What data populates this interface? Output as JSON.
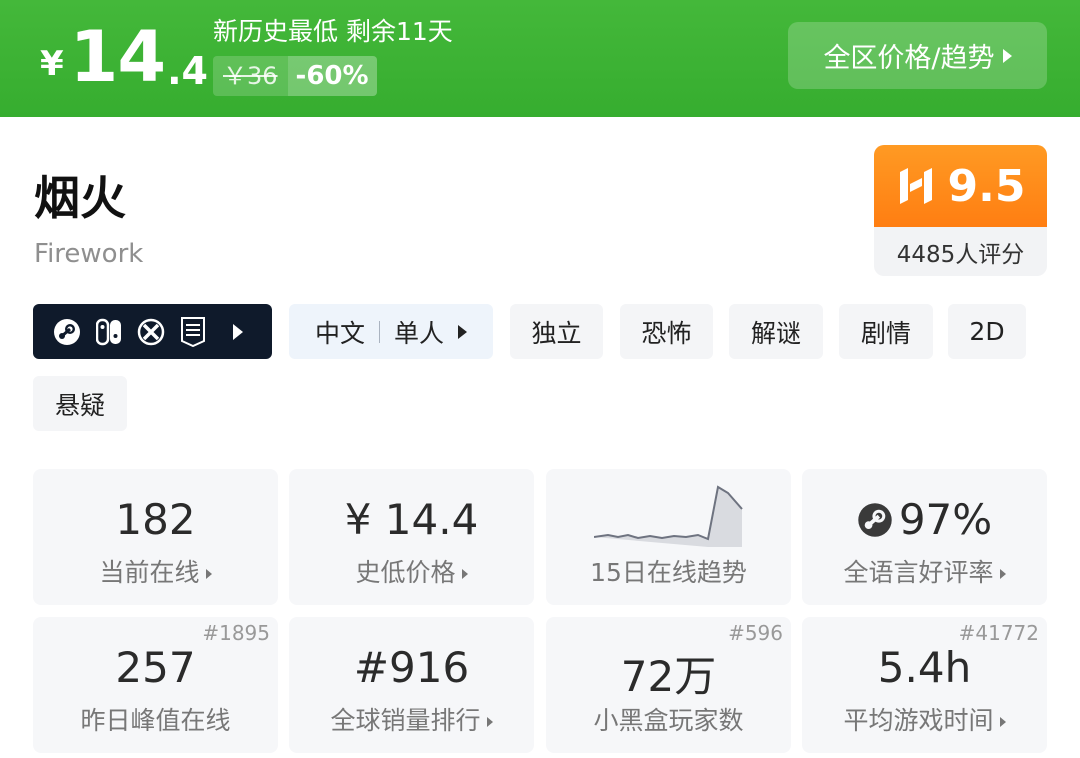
{
  "banner": {
    "currency": "¥",
    "price_int": "14",
    "price_dec": ".4",
    "promo_text": "新历史最低 剩余11天",
    "original_price": "￥36",
    "discount": "-60%",
    "region_button": "全区价格/趋势",
    "bg_color": "#3db435"
  },
  "game": {
    "title": "烟火",
    "subtitle": "Firework"
  },
  "score": {
    "value": "9.5",
    "count": "4485人评分",
    "accent": "#ff8a1a"
  },
  "platforms": {
    "icons": [
      "steam-icon",
      "switch-icon",
      "xbox-icon",
      "epic-games-icon"
    ]
  },
  "tags": {
    "lang_a": "中文",
    "lang_b": "单人",
    "items": [
      "独立",
      "恐怖",
      "解谜",
      "剧情",
      "2D",
      "悬疑"
    ]
  },
  "stats": [
    {
      "value": "182",
      "label": "当前在线"
    },
    {
      "value": "¥ 14.4",
      "label": "史低价格"
    },
    {
      "value": "",
      "label": "15日在线趋势"
    },
    {
      "value": "97%",
      "label": "全语言好评率"
    },
    {
      "value": "257",
      "label": "昨日峰值在线",
      "rank": "#1895"
    },
    {
      "value": "#916",
      "label": "全球销量排行"
    },
    {
      "value": "72万",
      "label": "小黑盒玩家数",
      "rank": "#596"
    },
    {
      "value": "5.4h",
      "label": "平均游戏时间",
      "rank": "#41772"
    }
  ]
}
